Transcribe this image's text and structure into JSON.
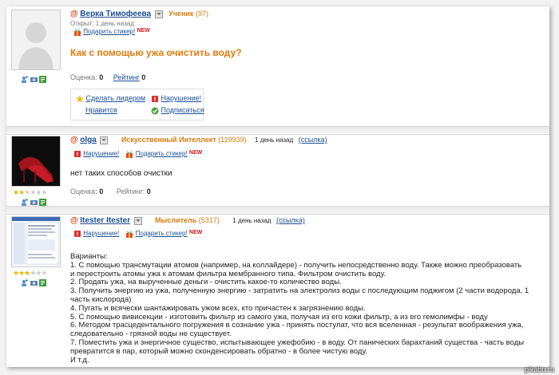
{
  "post1": {
    "user": "Верка Тимофеева",
    "rank": "Ученик",
    "rank_count": "(97)",
    "opened": "Открыт: 1 день назад",
    "gift": "Подарить стикер!",
    "new": "NEW",
    "title": "Как с помощью ужа очистить воду?",
    "score_label": "Оценка:",
    "score_value": "0",
    "rating_label": "Рейтинг",
    "rating_value": "0",
    "actions": {
      "leader": "Сделать лидером",
      "violation": "Нарушение!",
      "like": "Нравится",
      "subscribe": "Подписаться"
    }
  },
  "post2": {
    "user": "olga",
    "rank": "Искусственный Интеллект",
    "rank_count": "(119939)",
    "time": "1 день назад",
    "link": "(ссылка)",
    "violation": "Нарушение!",
    "gift": "Подарить стикер!",
    "new": "NEW",
    "text": "нет таких способов очистки",
    "score_label": "Оценка:",
    "score_value": "0",
    "rating_label": "Рейтинг:",
    "rating_value": "0",
    "stars_on": 2
  },
  "post3": {
    "user": "Itester Itester",
    "rank": "Мыслитель",
    "rank_count": "(5317)",
    "time": "1 день назад",
    "link": "(ссылка)",
    "violation": "Нарушение!",
    "gift": "Подарить стикер!",
    "new": "NEW",
    "stars_on": 3,
    "lines": [
      "Варианты:",
      "1. С помощью трансмутации атомов (например, на коллайдере) - получить непосредственно воду. Также можно преобразовать",
      "и перестроить атомы ужа к атомам фильтра мембранного типа. Фильтром очистить воду.",
      "2. Продать ужа, на вырученные деньги - очистить какое-то количество воды.",
      "3. Получить энергию из ужа, полученную энергию - затратить на электролиз воды с последующим поджигом (2 части водорода, 1",
      "часть кислорода)",
      "4. Пугать и всячески шантажировать ужом всех, кто причастен к загрязнению воды.",
      "5. С помощью вивисекции - изготовить фильтр из самого ужа, получая из его кожи фильтр, а из его гемолимфы - воду",
      "6. Методом трасцедентального погружения в сознание ужа - принять постулат, что вся вселенная - результат воображения ужа,",
      "следовательно - грязной воды не существует.",
      "7. Поместить ужа и энергичное существо, испытывающее ужефобию - в воду. От панических барахтаний существа - часть воды",
      "превратится в пар, который можно сконденсировать обратно - в более чистую воду.",
      "И т.д."
    ]
  },
  "watermark": "pikabu.ru"
}
